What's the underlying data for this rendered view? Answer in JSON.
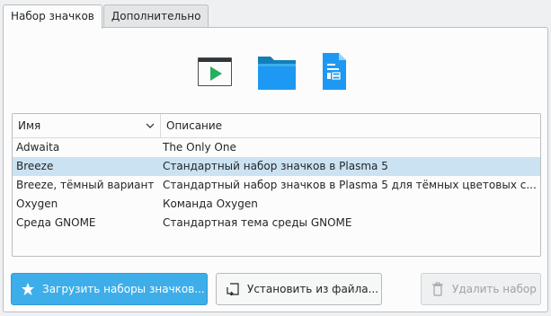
{
  "tabs": [
    {
      "label": "Набор значков",
      "active": true
    },
    {
      "label": "Дополнительно",
      "active": false
    }
  ],
  "preview_icons": [
    "video-player-icon",
    "folder-icon",
    "document-icon"
  ],
  "columns": {
    "name": "Имя",
    "description": "Описание"
  },
  "themes": [
    {
      "name": "Adwaita",
      "description": "The Only One",
      "selected": false
    },
    {
      "name": "Breeze",
      "description": "Стандартный набор значков в Plasma 5",
      "selected": true
    },
    {
      "name": "Breeze, тёмный вариант",
      "description": "Стандартный набор значков в Plasma 5 для тёмных цветовых с...",
      "selected": false
    },
    {
      "name": "Oxygen",
      "description": "Команда Oxygen",
      "selected": false
    },
    {
      "name": "Среда GNOME",
      "description": "Стандартная тема среды GNOME",
      "selected": false
    }
  ],
  "buttons": {
    "download": {
      "label": "Загрузить наборы значков...",
      "icon": "star-icon"
    },
    "install": {
      "label": "Установить из файла...",
      "icon": "install-file-icon"
    },
    "remove": {
      "label": "Удалить набор",
      "icon": "trash-icon",
      "enabled": false
    }
  },
  "colors": {
    "accent": "#3daee9",
    "selection": "#cbe2f2",
    "folder": "#1d99f3"
  }
}
